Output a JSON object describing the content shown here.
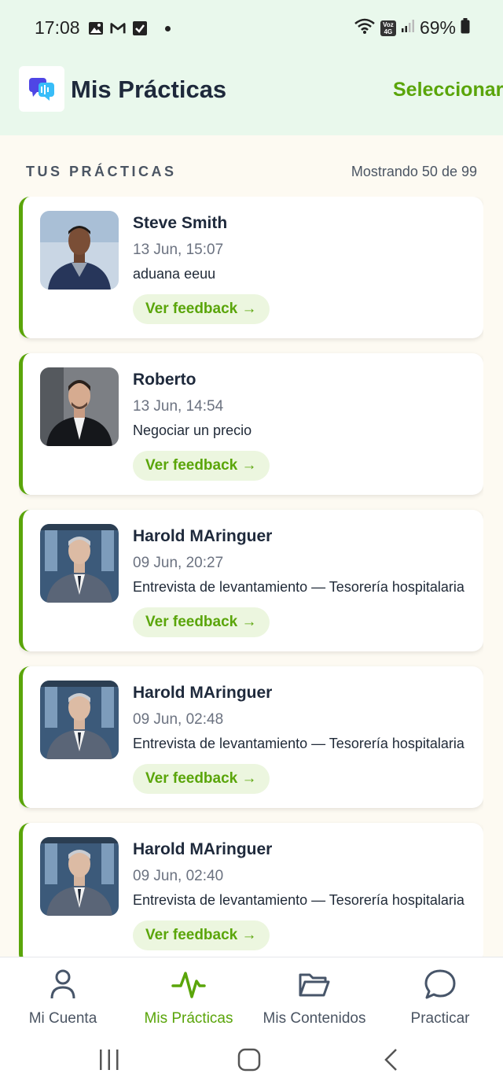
{
  "status_bar": {
    "time": "17:08",
    "battery": "69%",
    "volte": "Voz 4G"
  },
  "header": {
    "title": "Mis Prácticas",
    "select_label": "Seleccionar"
  },
  "section": {
    "label": "TUS PRÁCTICAS",
    "showing": "Mostrando 50 de 99"
  },
  "practices": [
    {
      "name": "Steve Smith",
      "date": "13 Jun, 15:07",
      "description": "aduana eeuu",
      "button": "Ver feedback →"
    },
    {
      "name": "Roberto",
      "date": "13 Jun, 14:54",
      "description": "Negociar un precio",
      "button": "Ver feedback →"
    },
    {
      "name": "Harold MAringuer",
      "date": "09 Jun, 20:27",
      "description": "Entrevista de levantamiento — Tesorería hospitalaria",
      "button": "Ver feedback →"
    },
    {
      "name": "Harold MAringuer",
      "date": "09 Jun, 02:48",
      "description": "Entrevista de levantamiento — Tesorería hospitalaria",
      "button": "Ver feedback →"
    },
    {
      "name": "Harold MAringuer",
      "date": "09 Jun, 02:40",
      "description": "Entrevista de levantamiento — Tesorería hospitalaria",
      "button": "Ver feedback →"
    }
  ],
  "bottom_nav": [
    {
      "label": "Mi Cuenta",
      "icon": "user-icon",
      "active": false
    },
    {
      "label": "Mis Prácticas",
      "icon": "activity-icon",
      "active": true
    },
    {
      "label": "Mis Contenidos",
      "icon": "folder-icon",
      "active": false
    },
    {
      "label": "Practicar",
      "icon": "chat-icon",
      "active": false
    }
  ],
  "colors": {
    "accent": "#5aa50a",
    "header_bg": "#e9f8ec",
    "page_bg": "#fdfaf2"
  }
}
